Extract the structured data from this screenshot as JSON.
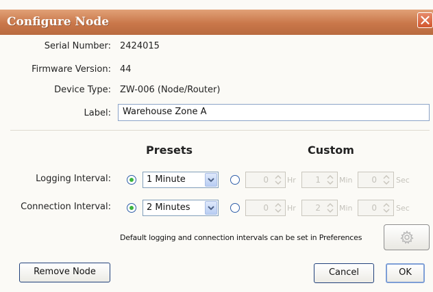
{
  "window": {
    "title": "Configure Node"
  },
  "info": {
    "serial_label": "Serial Number:",
    "serial_value": "2424015",
    "firmware_label": "Firmware Version:",
    "firmware_value": "44",
    "device_label": "Device Type:",
    "device_value": "ZW-006 (Node/Router)",
    "label_label": "Label:",
    "label_value": "Warehouse Zone A"
  },
  "intervals": {
    "presets_header": "Presets",
    "custom_header": "Custom",
    "logging": {
      "label": "Logging Interval:",
      "preset_value": "1 Minute",
      "preset_selected": true,
      "custom": {
        "hr": "0",
        "min": "1",
        "sec": "0"
      }
    },
    "connection": {
      "label": "Connection Interval:",
      "preset_value": "2 Minutes",
      "preset_selected": true,
      "custom": {
        "hr": "0",
        "min": "2",
        "sec": "0"
      }
    },
    "units": {
      "hr": "Hr",
      "min": "Min",
      "sec": "Sec"
    }
  },
  "note": "Default logging and connection intervals can be set in Preferences",
  "buttons": {
    "remove": "Remove Node",
    "cancel": "Cancel",
    "ok": "OK"
  },
  "icons": {
    "close": "close-icon",
    "preferences": "gear-icon"
  },
  "colors": {
    "titlebar": "#c9774a",
    "radio_selected": "#3db43f",
    "accent_border": "#7d9ed6"
  }
}
